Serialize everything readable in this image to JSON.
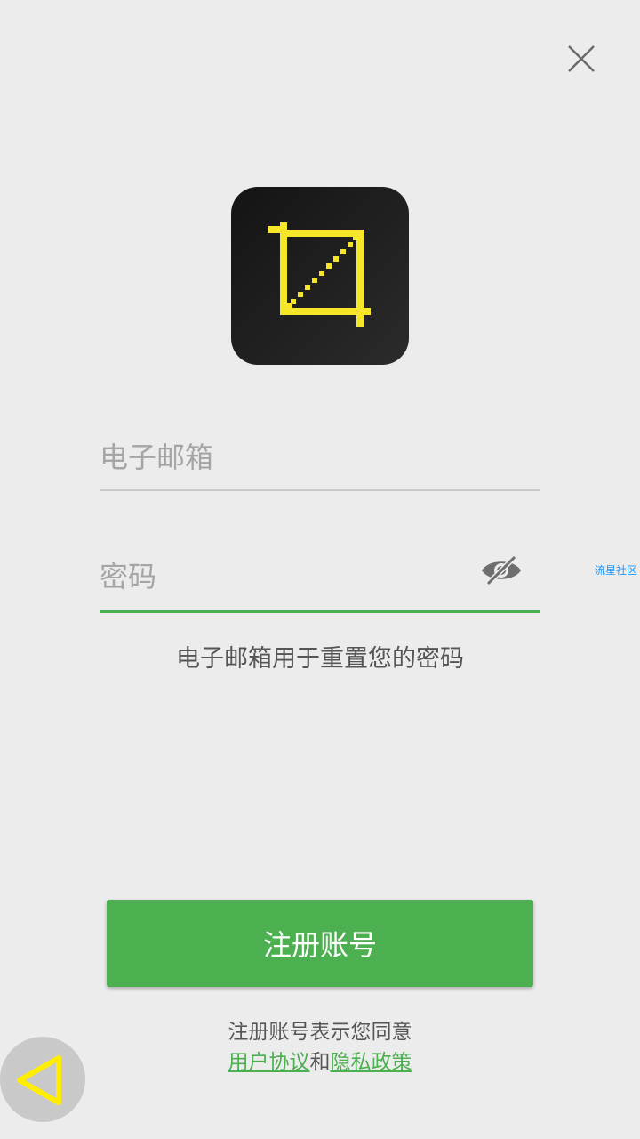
{
  "icons": {
    "close": "close-icon",
    "app_logo": "crop-icon",
    "eye": "eye-off-icon",
    "back": "triangle-back-icon"
  },
  "colors": {
    "background": "#ececec",
    "accent_green": "#4caf50",
    "logo_yellow": "#f5e62a",
    "logo_bg": "#1e1e1e",
    "link_blue": "#2196f3"
  },
  "form": {
    "email_placeholder": "电子邮箱",
    "password_placeholder": "密码",
    "hint": "电子邮箱用于重置您的密码"
  },
  "side_label": "流星社区",
  "register_button_label": "注册账号",
  "terms": {
    "prefix": "注册账号表示您同意",
    "user_agreement": "用户协议",
    "conjunction": "和",
    "privacy_policy": "隐私政策"
  }
}
